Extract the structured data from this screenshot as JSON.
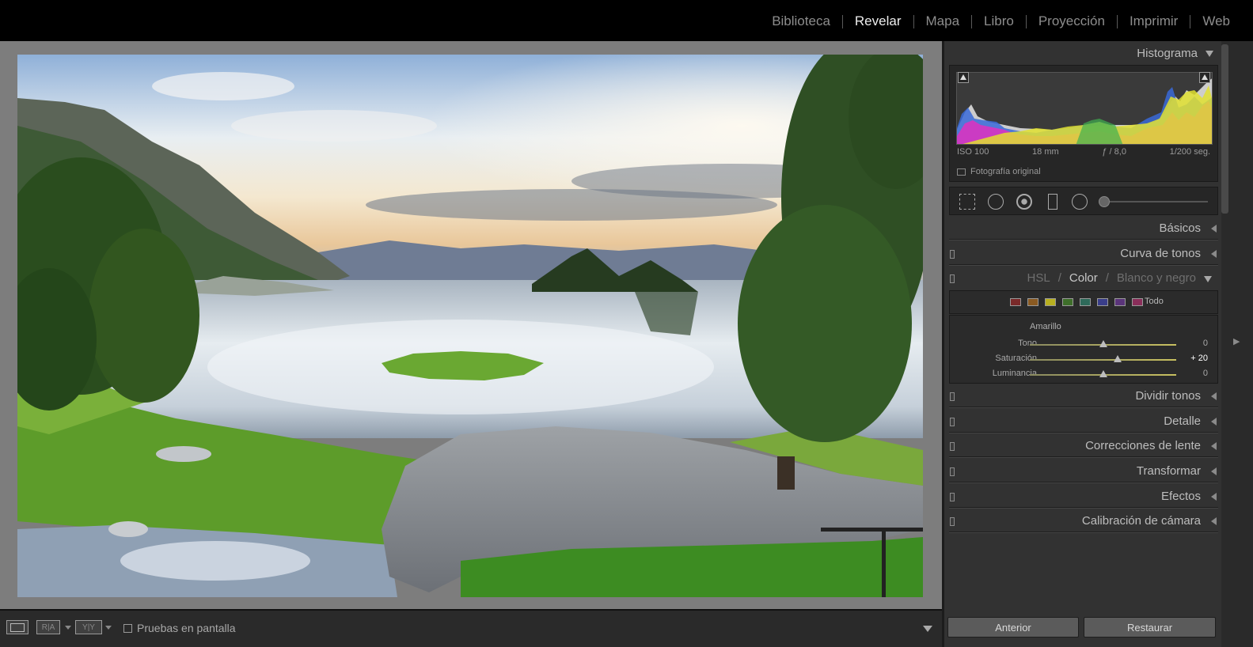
{
  "modules": [
    {
      "label": "Biblioteca",
      "active": false
    },
    {
      "label": "Revelar",
      "active": true
    },
    {
      "label": "Mapa",
      "active": false
    },
    {
      "label": "Libro",
      "active": false
    },
    {
      "label": "Proyección",
      "active": false
    },
    {
      "label": "Imprimir",
      "active": false
    },
    {
      "label": "Web",
      "active": false
    }
  ],
  "histogram": {
    "title": "Histograma",
    "iso": "ISO 100",
    "focal": "18 mm",
    "aperture": "ƒ / 8,0",
    "shutter": "1/200 seg.",
    "original_photo_label": "Fotografía original"
  },
  "panels": {
    "basicos": "Básicos",
    "curva": "Curva de tonos",
    "hsl_tab": "HSL",
    "color_tab": "Color",
    "bw_tab": "Blanco y negro",
    "tab_sep": "/",
    "dividir": "Dividir tonos",
    "detalle": "Detalle",
    "correcciones": "Correcciones de lente",
    "transformar": "Transformar",
    "efectos": "Efectos",
    "calibracion": "Calibración de cámara"
  },
  "color_panel": {
    "swatches": [
      "#7a2a2a",
      "#8a5a22",
      "#b8b020",
      "#3e6e2a",
      "#2e6a5a",
      "#3a3e8a",
      "#5a347a",
      "#8a2e5a"
    ],
    "all_label": "Todo",
    "selected_color": "Amarillo",
    "sliders": [
      {
        "label": "Tono",
        "value": "0",
        "level": 0.5,
        "changed": false
      },
      {
        "label": "Saturación",
        "value": "+ 20",
        "level": 0.6,
        "changed": true
      },
      {
        "label": "Luminancia",
        "value": "0",
        "level": 0.5,
        "changed": false
      }
    ]
  },
  "buttons": {
    "previous": "Anterior",
    "reset": "Restaurar"
  },
  "toolbar": {
    "compare_ra": "R|A",
    "compare_yy": "Y|Y",
    "soft_proofing": "Pruebas en pantalla"
  }
}
